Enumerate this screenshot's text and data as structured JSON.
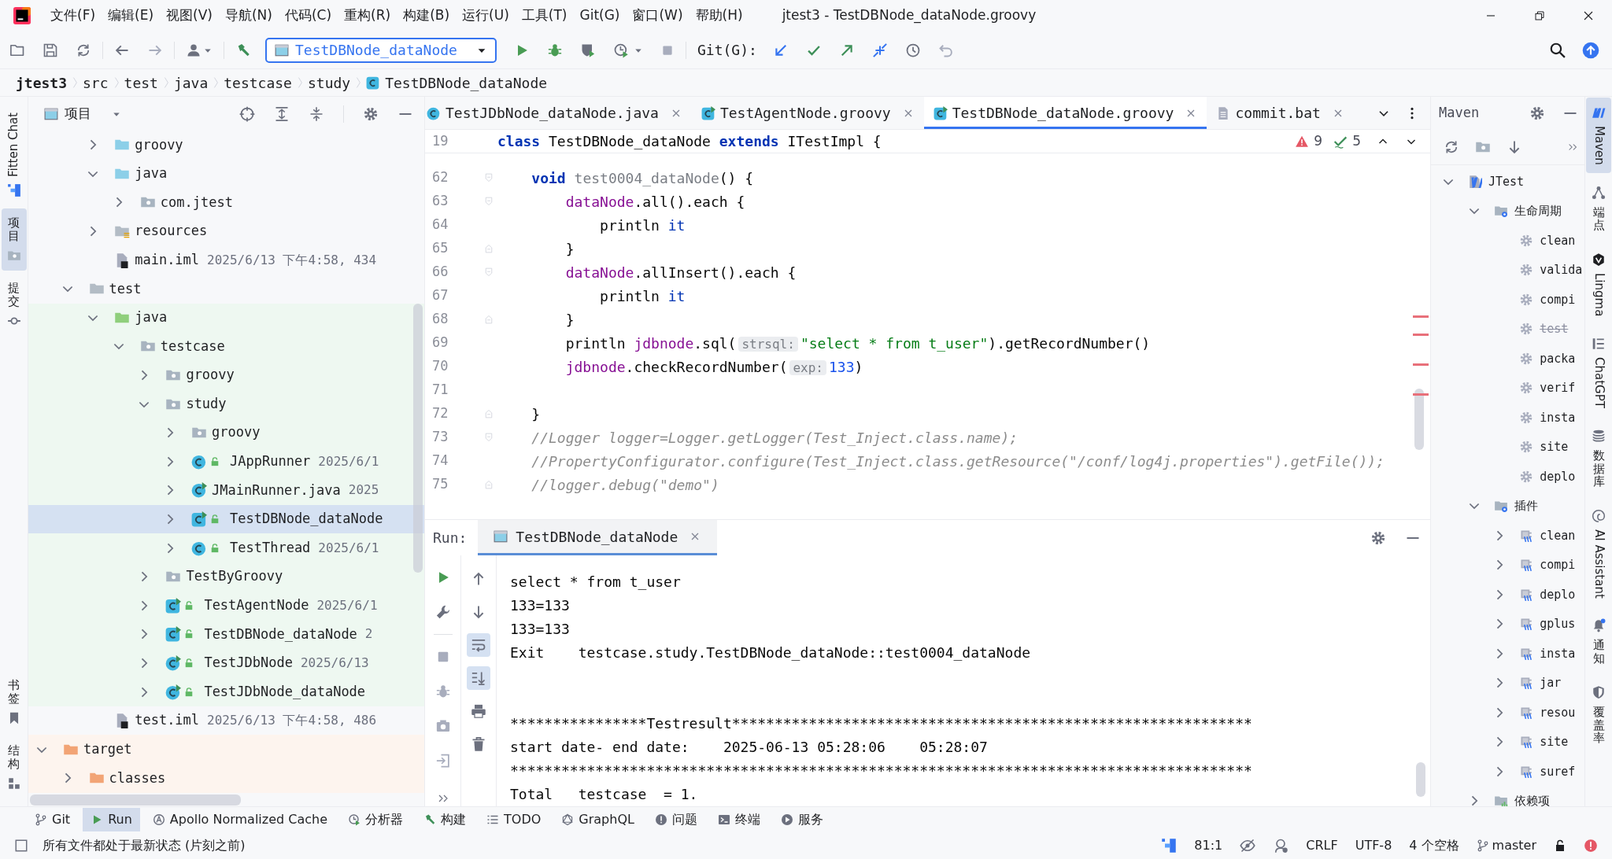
{
  "menu_bar": {
    "items": [
      "文件(F)",
      "编辑(E)",
      "视图(V)",
      "导航(N)",
      "代码(C)",
      "重构(R)",
      "构建(B)",
      "运行(U)",
      "工具(T)",
      "Git(G)",
      "窗口(W)",
      "帮助(H)"
    ],
    "title": "jtest3 - TestDBNode_dataNode.groovy"
  },
  "toolbar": {
    "run_configuration": "TestDBNode_dataNode",
    "git_label": "Git(G):"
  },
  "breadcrumbs": [
    {
      "label": "jtest3",
      "kind": "project"
    },
    {
      "label": "src",
      "kind": "folder"
    },
    {
      "label": "test",
      "kind": "folder"
    },
    {
      "label": "java",
      "kind": "folder"
    },
    {
      "label": "testcase",
      "kind": "folder"
    },
    {
      "label": "study",
      "kind": "folder"
    },
    {
      "label": "TestDBNode_dataNode",
      "kind": "class"
    }
  ],
  "left_strip": {
    "top": [
      {
        "label": "Fitten Chat",
        "kind": "fitten",
        "selected": false
      },
      {
        "label": "项目",
        "kind": "project",
        "selected": true
      },
      {
        "label": "提交",
        "kind": "commit",
        "selected": false
      }
    ],
    "bottom": [
      {
        "label": "书签",
        "kind": "bookmarks",
        "selected": false
      },
      {
        "label": "结构",
        "kind": "structure",
        "selected": false
      }
    ]
  },
  "project_panel": {
    "title": "项目",
    "tree": [
      {
        "children": [
          {
            "children": [
              {
                "label": "groovy",
                "kind": "source-folder",
                "expanded": false,
                "selected": false
              },
              {
                "label": "java",
                "kind": "source-folder",
                "expanded": true,
                "selected": false,
                "children": [
                  {
                    "label": "com.jtest",
                    "kind": "package",
                    "expanded": false,
                    "selected": false
                  }
                ]
              },
              {
                "label": "resources",
                "kind": "resources-folder",
                "expanded": false,
                "selected": false
              },
              {
                "label": "main.iml",
                "kind": "iml-file",
                "meta": "2025/6/13 下午4:58, 434",
                "selected": false
              }
            ]
          },
          {
            "label": "test",
            "kind": "folder",
            "expanded": true,
            "selected": false,
            "children": [
              {
                "label": "java",
                "kind": "test-folder",
                "expanded": true,
                "selected": false,
                "children": [
                  {
                    "label": "testcase",
                    "kind": "package",
                    "expanded": true,
                    "selected": false,
                    "children": [
                      {
                        "label": "groovy",
                        "kind": "package",
                        "expanded": false,
                        "selected": false
                      },
                      {
                        "label": "study",
                        "kind": "package",
                        "expanded": true,
                        "selected": false,
                        "children": [
                          {
                            "label": "groovy",
                            "kind": "package",
                            "expanded": false,
                            "selected": false
                          },
                          {
                            "label": "JAppRunner",
                            "kind": "java-class",
                            "runnable": false,
                            "locked": true,
                            "meta": "2025/6/1",
                            "expanded": false,
                            "selected": false
                          },
                          {
                            "label": "JMainRunner.java",
                            "kind": "java-class",
                            "runnable": true,
                            "locked": false,
                            "meta": "2025",
                            "expanded": false,
                            "selected": false
                          },
                          {
                            "label": "TestDBNode_dataNode",
                            "kind": "groovy-class",
                            "runnable": true,
                            "locked": true,
                            "expanded": false,
                            "selected": true
                          },
                          {
                            "label": "TestThread",
                            "kind": "java-class",
                            "runnable": false,
                            "locked": true,
                            "meta": "2025/6/1",
                            "expanded": false,
                            "selected": false
                          }
                        ]
                      },
                      {
                        "label": "TestByGroovy",
                        "kind": "package",
                        "expanded": false,
                        "selected": false
                      },
                      {
                        "label": "TestAgentNode",
                        "kind": "groovy-class",
                        "runnable": true,
                        "locked": true,
                        "meta": "2025/6/1",
                        "expanded": false,
                        "selected": false
                      },
                      {
                        "label": "TestDBNode_dataNode",
                        "kind": "groovy-class",
                        "runnable": true,
                        "locked": true,
                        "meta": "2",
                        "expanded": false,
                        "selected": false
                      },
                      {
                        "label": "TestJDbNode",
                        "kind": "java-class",
                        "runnable": true,
                        "locked": true,
                        "meta": "2025/6/13",
                        "expanded": false,
                        "selected": false
                      },
                      {
                        "label": "TestJDbNode_dataNode",
                        "kind": "java-class",
                        "runnable": true,
                        "locked": true,
                        "expanded": false,
                        "selected": false
                      }
                    ]
                  }
                ]
              },
              {
                "label": "test.iml",
                "kind": "iml-file",
                "meta": "2025/6/13 下午4:58, 486",
                "selected": false
              }
            ]
          }
        ]
      },
      {
        "label": "target",
        "kind": "excluded-folder",
        "expanded": true,
        "selected": false,
        "children": [
          {
            "label": "classes",
            "kind": "excluded-folder",
            "expanded": false,
            "selected": false
          }
        ]
      }
    ]
  },
  "editor": {
    "tabs": [
      {
        "label": "TestJDbNode_dataNode.java",
        "kind": "java",
        "selected": false
      },
      {
        "label": "TestAgentNode.groovy",
        "kind": "groovy",
        "selected": false
      },
      {
        "label": "TestDBNode_dataNode.groovy",
        "kind": "groovy",
        "selected": true
      },
      {
        "label": "commit.bat",
        "kind": "text",
        "selected": false
      }
    ],
    "sticky_line": {
      "number": "19",
      "tokens": [
        {
          "kind": "keyword",
          "text": "class "
        },
        {
          "kind": "plain",
          "text": "TestDBNode_dataNode "
        },
        {
          "kind": "keyword",
          "text": "extends "
        },
        {
          "kind": "plain",
          "text": "ITestImpl {"
        }
      ]
    },
    "problems": {
      "errors": "9",
      "warnings": "5"
    },
    "lines": [
      {
        "number": "62",
        "fold_start": true,
        "fold_end": false,
        "tokens": [
          {
            "kind": "keyword",
            "text": "    void "
          },
          {
            "kind": "unused",
            "text": "test0004_dataNode"
          },
          {
            "kind": "plain",
            "text": "() {"
          }
        ]
      },
      {
        "number": "63",
        "fold_start": true,
        "fold_end": false,
        "tokens": [
          {
            "kind": "field",
            "text": "        dataNode"
          },
          {
            "kind": "plain",
            "text": ".all().each {"
          }
        ]
      },
      {
        "number": "64",
        "fold_start": false,
        "fold_end": false,
        "tokens": [
          {
            "kind": "plain",
            "text": "            println "
          },
          {
            "kind": "implicit",
            "text": "it"
          }
        ]
      },
      {
        "number": "65",
        "fold_start": false,
        "fold_end": true,
        "tokens": [
          {
            "kind": "plain",
            "text": "        }"
          }
        ]
      },
      {
        "number": "66",
        "fold_start": true,
        "fold_end": false,
        "tokens": [
          {
            "kind": "field",
            "text": "        dataNode"
          },
          {
            "kind": "plain",
            "text": ".allInsert().each {"
          }
        ]
      },
      {
        "number": "67",
        "fold_start": false,
        "fold_end": false,
        "tokens": [
          {
            "kind": "plain",
            "text": "            println "
          },
          {
            "kind": "implicit",
            "text": "it"
          }
        ]
      },
      {
        "number": "68",
        "fold_start": false,
        "fold_end": true,
        "tokens": [
          {
            "kind": "plain",
            "text": "        }"
          }
        ]
      },
      {
        "number": "69",
        "fold_start": false,
        "fold_end": false,
        "tokens": [
          {
            "kind": "plain",
            "text": "        println "
          },
          {
            "kind": "field",
            "text": "jdbnode"
          },
          {
            "kind": "plain",
            "text": ".sql("
          },
          {
            "kind": "hint",
            "text": "strsql:"
          },
          {
            "kind": "string",
            "text": "\"select * from t_user\""
          },
          {
            "kind": "plain",
            "text": ").getRecordNumber()"
          }
        ]
      },
      {
        "number": "70",
        "fold_start": false,
        "fold_end": false,
        "tokens": [
          {
            "kind": "field",
            "text": "        jdbnode"
          },
          {
            "kind": "plain",
            "text": ".checkRecordNumber("
          },
          {
            "kind": "hint",
            "text": "exp:"
          },
          {
            "kind": "number",
            "text": "133"
          },
          {
            "kind": "plain",
            "text": ")"
          }
        ]
      },
      {
        "number": "71",
        "fold_start": false,
        "fold_end": false
      },
      {
        "number": "72",
        "fold_start": false,
        "fold_end": true,
        "tokens": [
          {
            "kind": "plain",
            "text": "    }"
          }
        ]
      },
      {
        "number": "73",
        "fold_start": true,
        "fold_end": false,
        "tokens": [
          {
            "kind": "comment",
            "text": "    //Logger logger=Logger.getLogger(Test_Inject.class.name);"
          }
        ]
      },
      {
        "number": "74",
        "fold_start": false,
        "fold_end": false,
        "tokens": [
          {
            "kind": "comment",
            "text": "    //PropertyConfigurator.configure(Test_Inject.class.getResource(\"/conf/log4j.properties\").getFile());"
          }
        ]
      },
      {
        "number": "75",
        "fold_start": false,
        "fold_end": true,
        "tokens": [
          {
            "kind": "comment",
            "text": "    //logger.debug(\"demo\")"
          }
        ]
      }
    ]
  },
  "run_panel": {
    "label": "Run:",
    "tab": "TestDBNode_dataNode",
    "soft_wrap": true,
    "scroll_to_end": true,
    "output": [
      "select * from t_user",
      "133=133",
      "133=133",
      "Exit    testcase.study.TestDBNode_dataNode::test0004_dataNode"
    ],
    "summary": [
      "****************Testresult*************************************************************",
      "start date- end date:    2025-06-13 05:28:06    05:28:07",
      "***************************************************************************************",
      "Total   testcase  = 1."
    ]
  },
  "maven_panel": {
    "title": "Maven",
    "tree": [
      {
        "label": "JTest",
        "kind": "project",
        "expanded": true,
        "selected": false,
        "children": [
          {
            "label": "生命周期",
            "kind": "group",
            "expanded": true,
            "selected": false,
            "children": [
              {
                "label": "clean",
                "kind": "goal",
                "disabled": false,
                "selected": false
              },
              {
                "label": "valida",
                "kind": "goal",
                "disabled": false,
                "selected": false
              },
              {
                "label": "compi",
                "kind": "goal",
                "disabled": false,
                "selected": false
              },
              {
                "label": "test",
                "kind": "goal",
                "disabled": true,
                "selected": false
              },
              {
                "label": "packa",
                "kind": "goal",
                "disabled": false,
                "selected": false
              },
              {
                "label": "verif",
                "kind": "goal",
                "disabled": false,
                "selected": false
              },
              {
                "label": "insta",
                "kind": "goal",
                "disabled": false,
                "selected": false
              },
              {
                "label": "site",
                "kind": "goal",
                "disabled": false,
                "selected": false
              },
              {
                "label": "deplo",
                "kind": "goal",
                "disabled": false,
                "selected": false
              }
            ]
          },
          {
            "label": "插件",
            "kind": "group",
            "expanded": true,
            "selected": false,
            "children": [
              {
                "label": "clean",
                "kind": "plugin",
                "expanded": false,
                "selected": false
              },
              {
                "label": "compi",
                "kind": "plugin",
                "expanded": false,
                "selected": false
              },
              {
                "label": "deplo",
                "kind": "plugin",
                "expanded": false,
                "selected": false
              },
              {
                "label": "gplus",
                "kind": "plugin",
                "expanded": false,
                "selected": false
              },
              {
                "label": "insta",
                "kind": "plugin",
                "expanded": false,
                "selected": false
              },
              {
                "label": "jar",
                "kind": "plugin",
                "expanded": false,
                "selected": false
              },
              {
                "label": "resou",
                "kind": "plugin",
                "expanded": false,
                "selected": false
              },
              {
                "label": "site",
                "kind": "plugin",
                "expanded": false,
                "selected": false
              },
              {
                "label": "suref",
                "kind": "plugin",
                "expanded": false,
                "selected": false
              }
            ]
          },
          {
            "label": "依赖项",
            "kind": "dependencies",
            "expanded": false,
            "selected": false
          }
        ]
      }
    ]
  },
  "right_strip": [
    {
      "label": "Maven",
      "kind": "maven",
      "selected": true
    },
    {
      "label": "端点",
      "kind": "endpoints",
      "selected": false
    },
    {
      "label": "Lingma",
      "kind": "lingma",
      "selected": false
    },
    {
      "label": "ChatGPT",
      "kind": "chatgpt",
      "selected": false
    },
    {
      "label": "数据库",
      "kind": "database",
      "selected": false
    },
    {
      "label": "AI Assistant",
      "kind": "ai",
      "selected": false
    },
    {
      "label": "通知",
      "kind": "notifications",
      "selected": false
    },
    {
      "label": "覆盖率",
      "kind": "coverage",
      "selected": false
    }
  ],
  "tool_window_bar": [
    {
      "label": "Git",
      "kind": "git",
      "selected": false
    },
    {
      "label": "Run",
      "kind": "run",
      "selected": true
    },
    {
      "label": "Apollo Normalized Cache",
      "kind": "apollo",
      "selected": false
    },
    {
      "label": "分析器",
      "kind": "profiler",
      "selected": false
    },
    {
      "label": "构建",
      "kind": "build",
      "selected": false
    },
    {
      "label": "TODO",
      "kind": "todo",
      "selected": false
    },
    {
      "label": "GraphQL",
      "kind": "graphql",
      "selected": false
    },
    {
      "label": "问题",
      "kind": "problems",
      "selected": false
    },
    {
      "label": "终端",
      "kind": "terminal",
      "selected": false
    },
    {
      "label": "服务",
      "kind": "services",
      "selected": false
    }
  ],
  "status_bar": {
    "message": "所有文件都处于最新状态 (片刻之前)",
    "caret_position": "81:1",
    "line_separator": "CRLF",
    "encoding": "UTF-8",
    "indent": "4 个空格",
    "branch": "master"
  }
}
